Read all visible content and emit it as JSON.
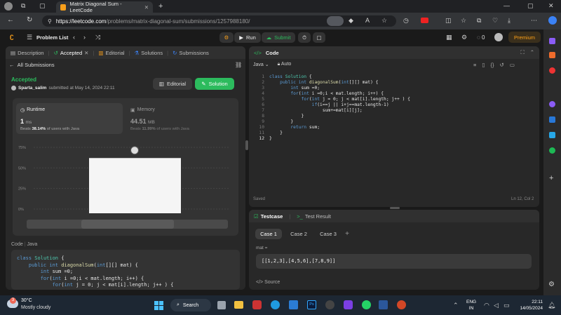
{
  "browser": {
    "tab_title": "Matrix Diagonal Sum - LeetCode",
    "url": "https://leetcode.com/problems/matrix-diagonal-sum/submissions/1257988180/",
    "url_host": "https://leetcode.com",
    "url_path": "/problems/matrix-diagonal-sum/submissions/1257988180/"
  },
  "nav": {
    "problem_list": "Problem List",
    "run": "Run",
    "submit": "Submit",
    "streak": "0",
    "premium": "Premium"
  },
  "left_tabs": {
    "description": "Description",
    "accepted": "Accepted",
    "editorial": "Editorial",
    "solutions": "Solutions",
    "submissions": "Submissions"
  },
  "submission": {
    "back": "All Submissions",
    "status": "Accepted",
    "user": "Sparta_salim",
    "submitted_at": "submitted at May 14, 2024 22:11",
    "editorial_btn": "Editorial",
    "solution_btn": "Solution",
    "runtime_label": "Runtime",
    "runtime_value": "1",
    "runtime_unit": "ms",
    "runtime_beats_prefix": "Beats",
    "runtime_beats": "38.14%",
    "runtime_beats_suffix": "of users with Java",
    "memory_label": "Memory",
    "memory_value": "44.51",
    "memory_unit": "MB",
    "memory_beats_prefix": "Beats",
    "memory_beats": "11.99%",
    "memory_beats_suffix": "of users with Java",
    "code_label": "Code",
    "code_lang": "Java"
  },
  "chart_data": {
    "type": "bar",
    "y_ticks": [
      "75%",
      "50%",
      "25%",
      "0%"
    ],
    "ylim": [
      0,
      75
    ],
    "bar_value": 62
  },
  "left_code": [
    "class Solution {",
    "    public int diagonalSum(int[][] mat) {",
    "        int sum =0;",
    "        for(int i =0;i < mat.length; i++) {",
    "            for(int j = 0; j < mat[i].length; j++ ) {"
  ],
  "editor": {
    "title": "Code",
    "lang": "Java",
    "auto": "Auto",
    "saved": "Saved",
    "cursor": "Ln 12, Col 2",
    "lines": [
      "class Solution {",
      "    public int diagonalSum(int[][] mat) {",
      "        int sum =0;",
      "        for(int i =0;i < mat.length; i++) {",
      "            for(int j = 0; j < mat[i].length; j++ ) {",
      "                if(i==j || i+j==mat.length-1)",
      "                    sum+=mat[i][j];",
      "            }",
      "        }",
      "        return sum;",
      "    }",
      "}"
    ],
    "line_numbers": [
      "1",
      "2",
      "3",
      "4",
      "5",
      "6",
      "7",
      "8",
      "9",
      "10",
      "11",
      "12"
    ]
  },
  "testcase": {
    "tab_testcase": "Testcase",
    "tab_result": "Test Result",
    "cases": [
      "Case 1",
      "Case 2",
      "Case 3"
    ],
    "add": "+",
    "input_label": "mat =",
    "input_value": "[[1,2,3],[4,5,6],[7,8,9]]",
    "source": "Source"
  },
  "taskbar": {
    "weather_temp": "30°C",
    "weather_desc": "Mostly cloudy",
    "search": "Search",
    "lang_top": "ENG",
    "lang_bottom": "IN",
    "time": "22:11",
    "date": "14/05/2024",
    "notif_badge": "3"
  },
  "colors": {
    "accent_green": "#2cbb5d",
    "premium": "#ffa116",
    "bg": "#1a1a1a",
    "panel": "#282828"
  }
}
